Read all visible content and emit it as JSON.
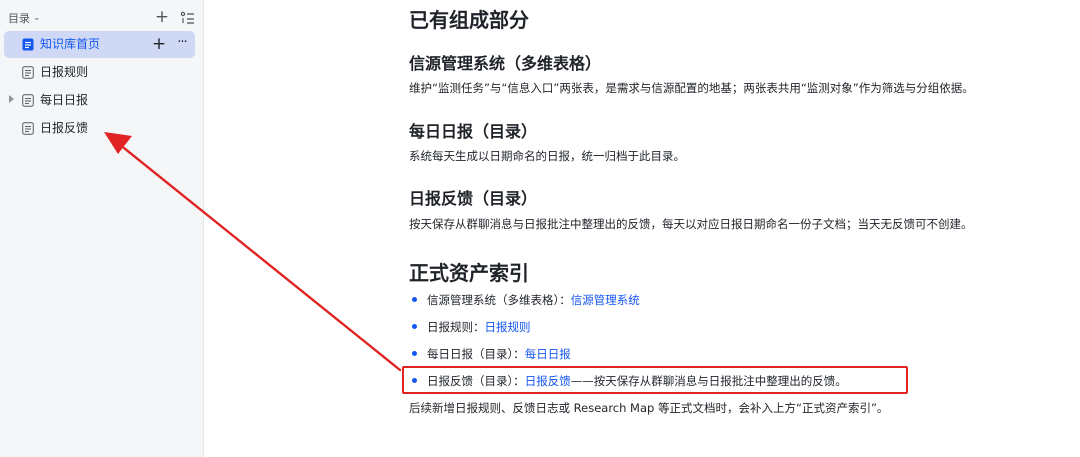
{
  "sidebar": {
    "title": "目录",
    "items": [
      {
        "label": "知识库首页",
        "active": true
      },
      {
        "label": "日报规则",
        "active": false
      },
      {
        "label": "每日日报",
        "active": false,
        "expandable": true
      },
      {
        "label": "日报反馈",
        "active": false
      }
    ]
  },
  "content": {
    "section1_heading": "已有组成部分",
    "blocks": [
      {
        "heading": "信源管理系统（多维表格）",
        "text": "维护“监测任务”与“信息入口”两张表，是需求与信源配置的地基；两张表共用“监测对象”作为筛选与分组依据。"
      },
      {
        "heading": "每日日报（目录）",
        "text": "系统每天生成以日期命名的日报，统一归档于此目录。"
      },
      {
        "heading": "日报反馈（目录）",
        "text": "按天保存从群聊消息与日报批注中整理出的反馈，每天以对应日报日期命名一份子文档；当天无反馈可不创建。"
      }
    ],
    "section2_heading": "正式资产索引",
    "index_items": [
      {
        "prefix": "信源管理系统（多维表格）：",
        "link": "信源管理系统",
        "suffix": ""
      },
      {
        "prefix": "日报规则：",
        "link": "日报规则",
        "suffix": ""
      },
      {
        "prefix": "每日日报（目录）：",
        "link": "每日日报",
        "suffix": ""
      },
      {
        "prefix": "日报反馈（目录）：",
        "link": "日报反馈",
        "suffix": "——按天保存从群聊消息与日报批注中整理出的反馈。"
      }
    ],
    "footer_text": "后续新增日报规则、反馈日志或 Research Map 等正式文档时，会补入上方“正式资产索引”。"
  },
  "annotation": {
    "color": "#e02424"
  }
}
